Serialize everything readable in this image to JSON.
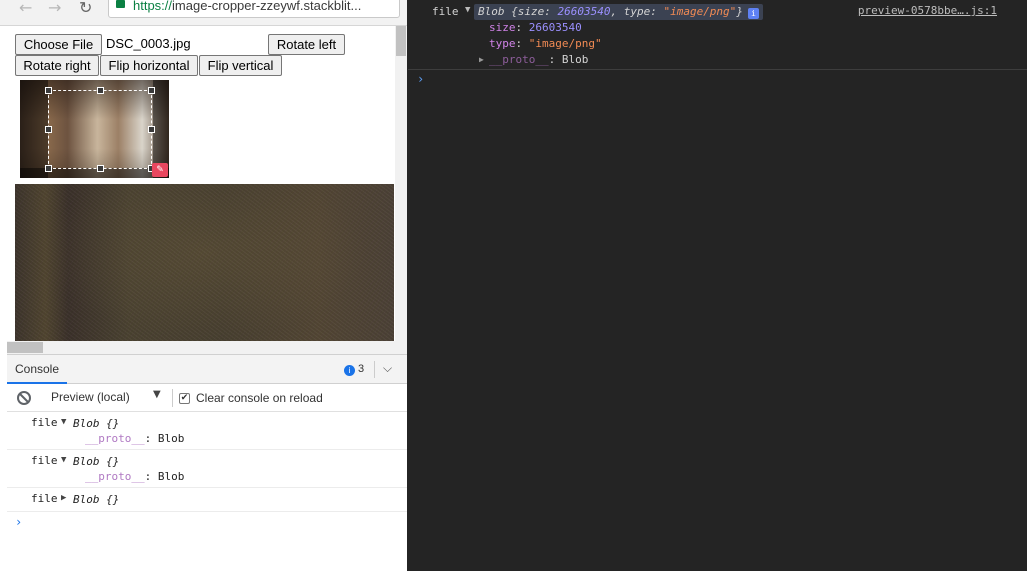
{
  "browser": {
    "back_icon": "arrow-left-icon",
    "forward_icon": "arrow-right-icon",
    "reload_icon": "reload-icon",
    "url_scheme": "https://",
    "url_rest": "image-cropper-zzeywf.stackblit..."
  },
  "page": {
    "choose_file_label": "Choose File",
    "file_name": "DSC_0003.jpg",
    "rotate_left_label": "Rotate left",
    "rotate_right_label": "Rotate right",
    "flip_horizontal_label": "Flip horizontal",
    "flip_vertical_label": "Flip vertical"
  },
  "drawer": {
    "tab_label": "Console",
    "info_count": "3",
    "context": "Preview (local)",
    "clear_label": "Clear console on reload",
    "clear_checked": true,
    "logs": [
      {
        "key": "file",
        "expanded": true,
        "summary": "Blob {}",
        "proto_key": "__proto__",
        "proto_value": ": Blob"
      },
      {
        "key": "file",
        "expanded": true,
        "summary": "Blob {}",
        "proto_key": "__proto__",
        "proto_value": ": Blob"
      },
      {
        "key": "file",
        "expanded": false,
        "summary": "Blob {}"
      }
    ],
    "prompt": "›"
  },
  "devtools": {
    "entry_key": "file",
    "summary_prefix": "Blob {size: ",
    "summary_size": "26603540",
    "summary_mid": ", type: ",
    "summary_type": "\"image/png\"",
    "summary_suffix": "}",
    "info_badge": "i",
    "source": "preview-0578bbe….js:1",
    "props": [
      {
        "key": "size",
        "sep": ": ",
        "value": "26603540",
        "kind": "num"
      },
      {
        "key": "type",
        "sep": ": ",
        "value": "\"image/png\"",
        "kind": "str"
      }
    ],
    "proto_key": "__proto__",
    "proto_value": ": Blob",
    "prompt": "›",
    "colors": {
      "number": "#9b90ff",
      "string": "#f28b54",
      "key": "#d183e8",
      "background": "#242424"
    }
  }
}
